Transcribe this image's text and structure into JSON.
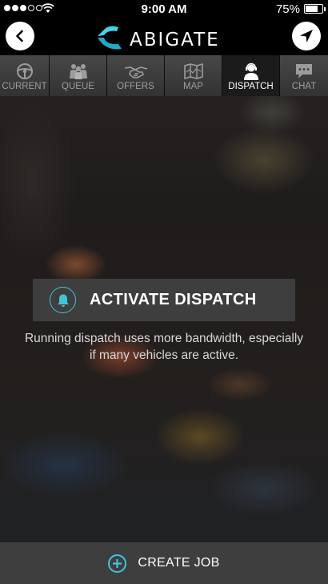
{
  "status_bar": {
    "signal_dots_filled": 3,
    "signal_dots_total": 5,
    "time": "9:00 AM",
    "battery_percent": "75%",
    "battery_level": 0.75
  },
  "header": {
    "logo_text": "ABIGATE",
    "back_icon": "chevron-left-icon",
    "locate_icon": "navigation-arrow-icon"
  },
  "tabs": [
    {
      "label": "CURRENT",
      "icon": "steering-wheel-icon",
      "active": false
    },
    {
      "label": "QUEUE",
      "icon": "people-group-icon",
      "active": false
    },
    {
      "label": "OFFERS",
      "icon": "handshake-icon",
      "active": false
    },
    {
      "label": "MAP",
      "icon": "map-icon",
      "active": false
    },
    {
      "label": "DISPATCH",
      "icon": "dispatcher-headset-icon",
      "active": true
    },
    {
      "label": "CHAT",
      "icon": "chat-bubble-icon",
      "active": false
    }
  ],
  "main": {
    "activate_label": "ACTIVATE DISPATCH",
    "note": "Running dispatch uses more bandwidth, especially if many vehicles are active."
  },
  "bottom": {
    "create_label": "CREATE JOB"
  },
  "colors": {
    "accent": "#40c4dc",
    "bar_bg": "#000000",
    "button_bg": "#3e3e3e"
  }
}
